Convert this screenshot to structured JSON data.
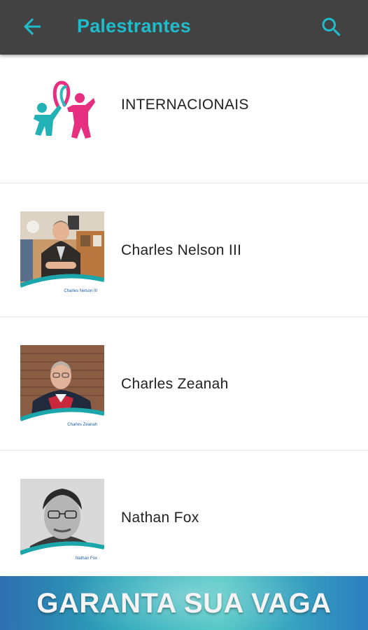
{
  "appbar": {
    "title": "Palestrantes",
    "back_icon": "arrow-back-icon",
    "search_icon": "search-icon",
    "accent_color": "#1fbccb",
    "background_color": "#424242"
  },
  "items": [
    {
      "label": "INTERNACIONAIS",
      "icon": "people-ribbon-logo-icon"
    },
    {
      "label": "Charles Nelson III",
      "photo_caption": "Charles Nelson III"
    },
    {
      "label": "Charles Zeanah",
      "photo_caption": "Charles Zeanah"
    },
    {
      "label": "Nathan Fox",
      "photo_caption": "Nathan Fox"
    }
  ],
  "banner": {
    "text": "GARANTA SUA VAGA"
  }
}
